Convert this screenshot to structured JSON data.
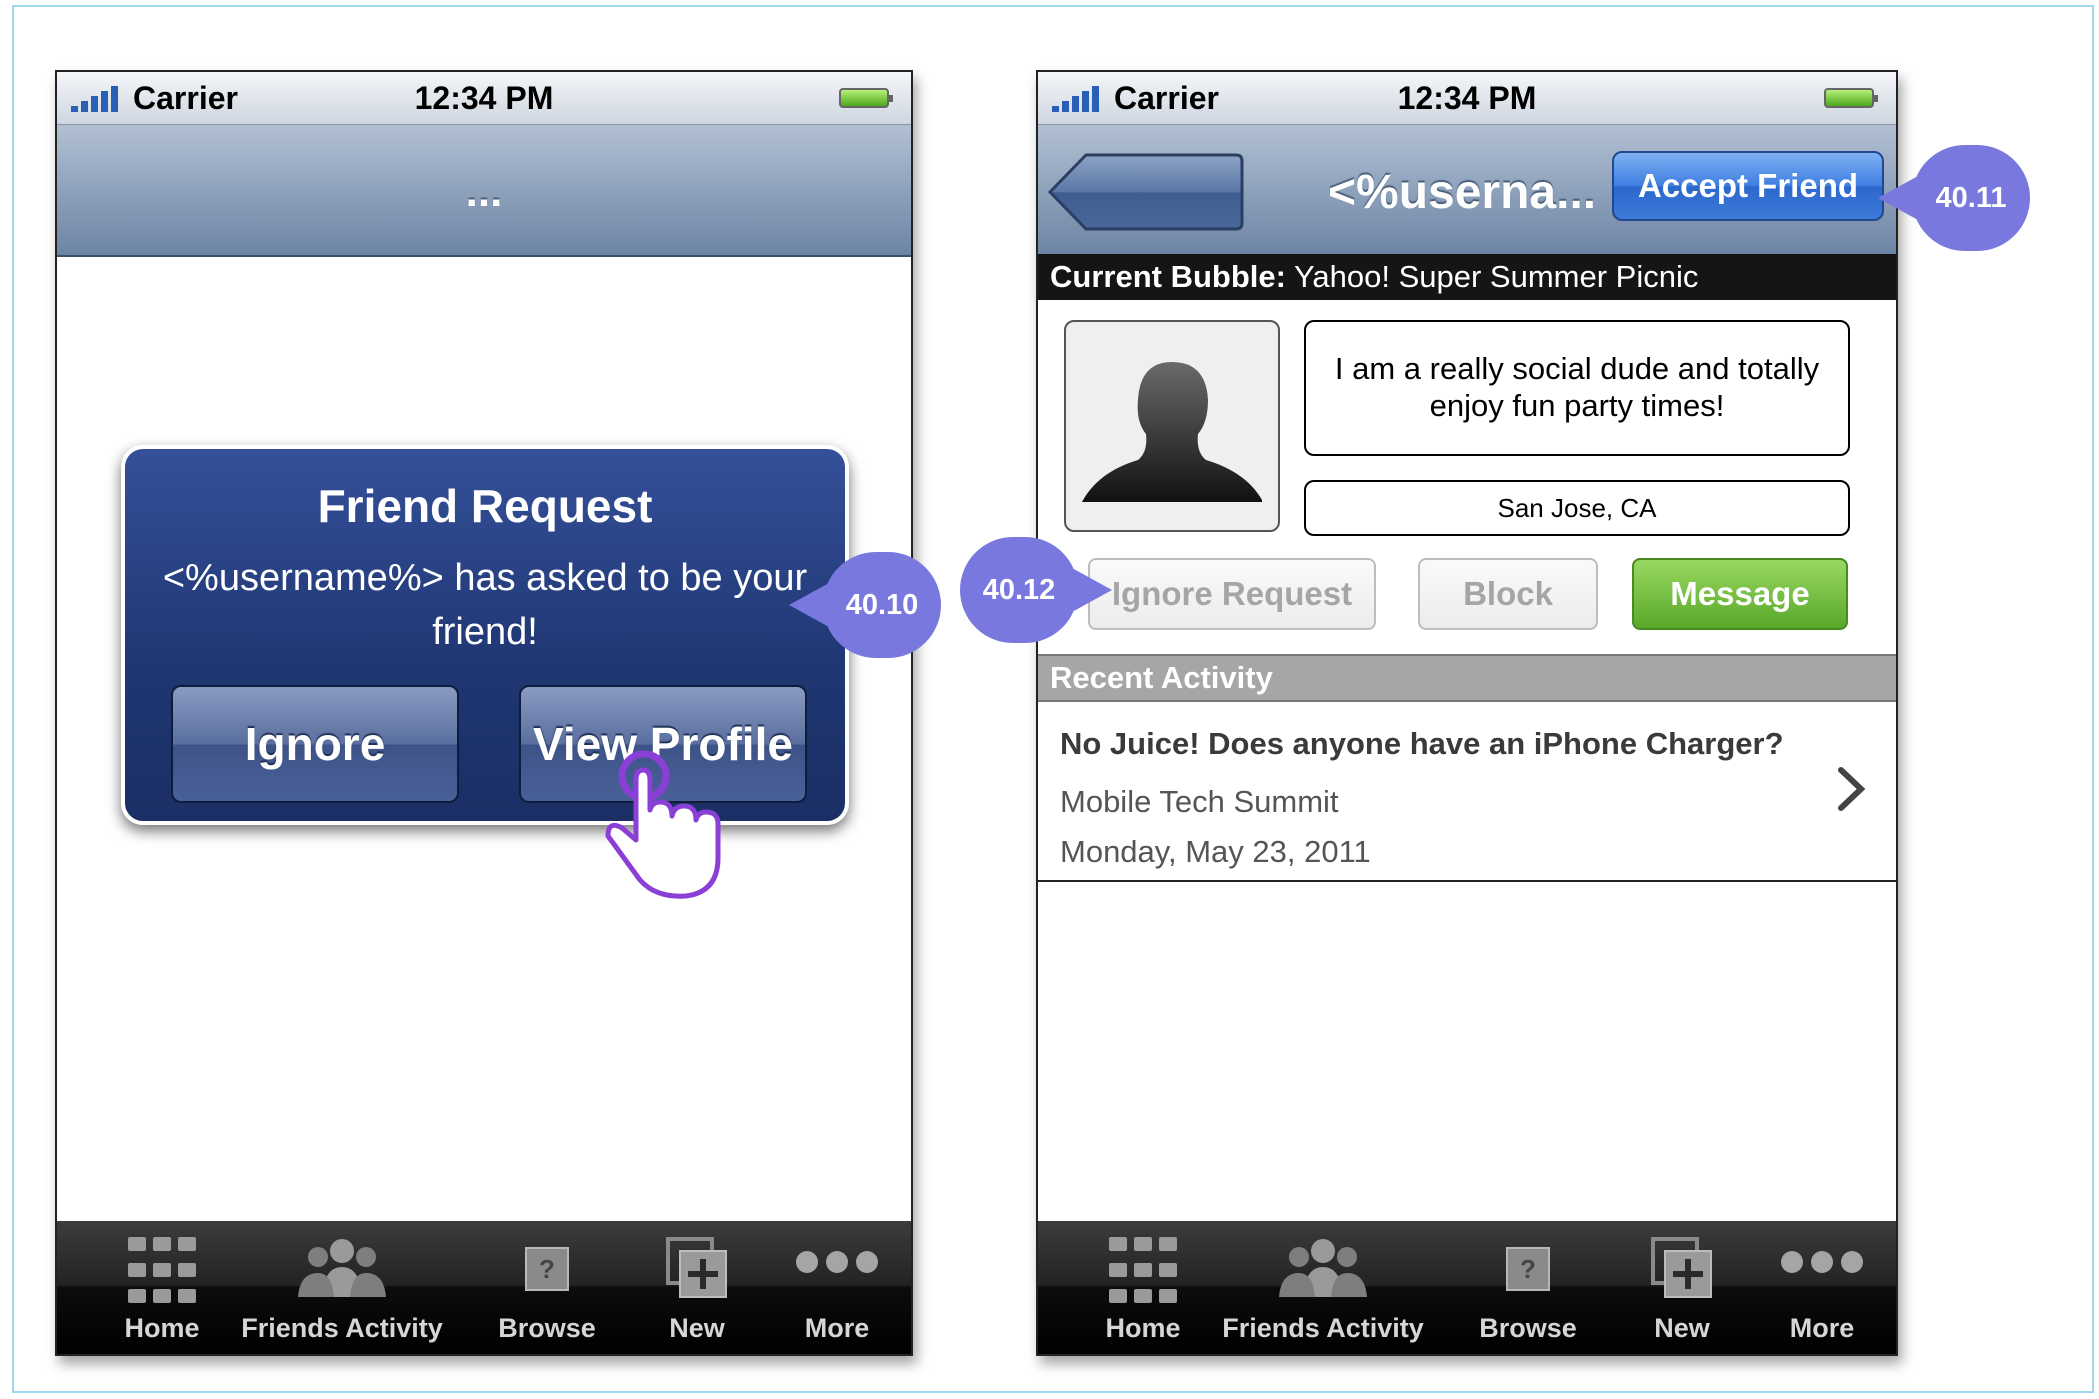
{
  "status_bar": {
    "carrier": "Carrier",
    "time": "12:34 PM"
  },
  "left_screen": {
    "nav_title": "...",
    "alert": {
      "title": "Friend Request",
      "message": "<%username%> has asked to be your friend!",
      "ignore_label": "Ignore",
      "view_profile_label": "View Profile"
    },
    "callout": "40.10"
  },
  "right_screen": {
    "nav_title": "<%userna...",
    "accept_label": "Accept Friend",
    "callout_accept": "40.11",
    "callout_ignore": "40.12",
    "bubble_label": "Current Bubble:",
    "bubble_value": "Yahoo! Super Summer Picnic",
    "bio": "I am a really social dude and totally enjoy fun party times!",
    "location": "San Jose, CA",
    "buttons": {
      "ignore_request": "Ignore Request",
      "block": "Block",
      "message": "Message"
    },
    "section_title": "Recent Activity",
    "activity": {
      "title": "No Juice! Does anyone have an iPhone Charger?",
      "event": "Mobile Tech Summit",
      "date": "Monday, May 23, 2011"
    }
  },
  "tab_bar": [
    {
      "label": "Home",
      "icon": "grid-icon"
    },
    {
      "label": "Friends Activity",
      "icon": "friends-icon"
    },
    {
      "label": "Browse",
      "icon": "browse-icon"
    },
    {
      "label": "New",
      "icon": "new-icon"
    },
    {
      "label": "More",
      "icon": "more-icon"
    }
  ],
  "colors": {
    "callout": "#7878de",
    "accept_button": "#3e7ee0",
    "message_button": "#59a82a",
    "alert_background": "#1f3672"
  }
}
